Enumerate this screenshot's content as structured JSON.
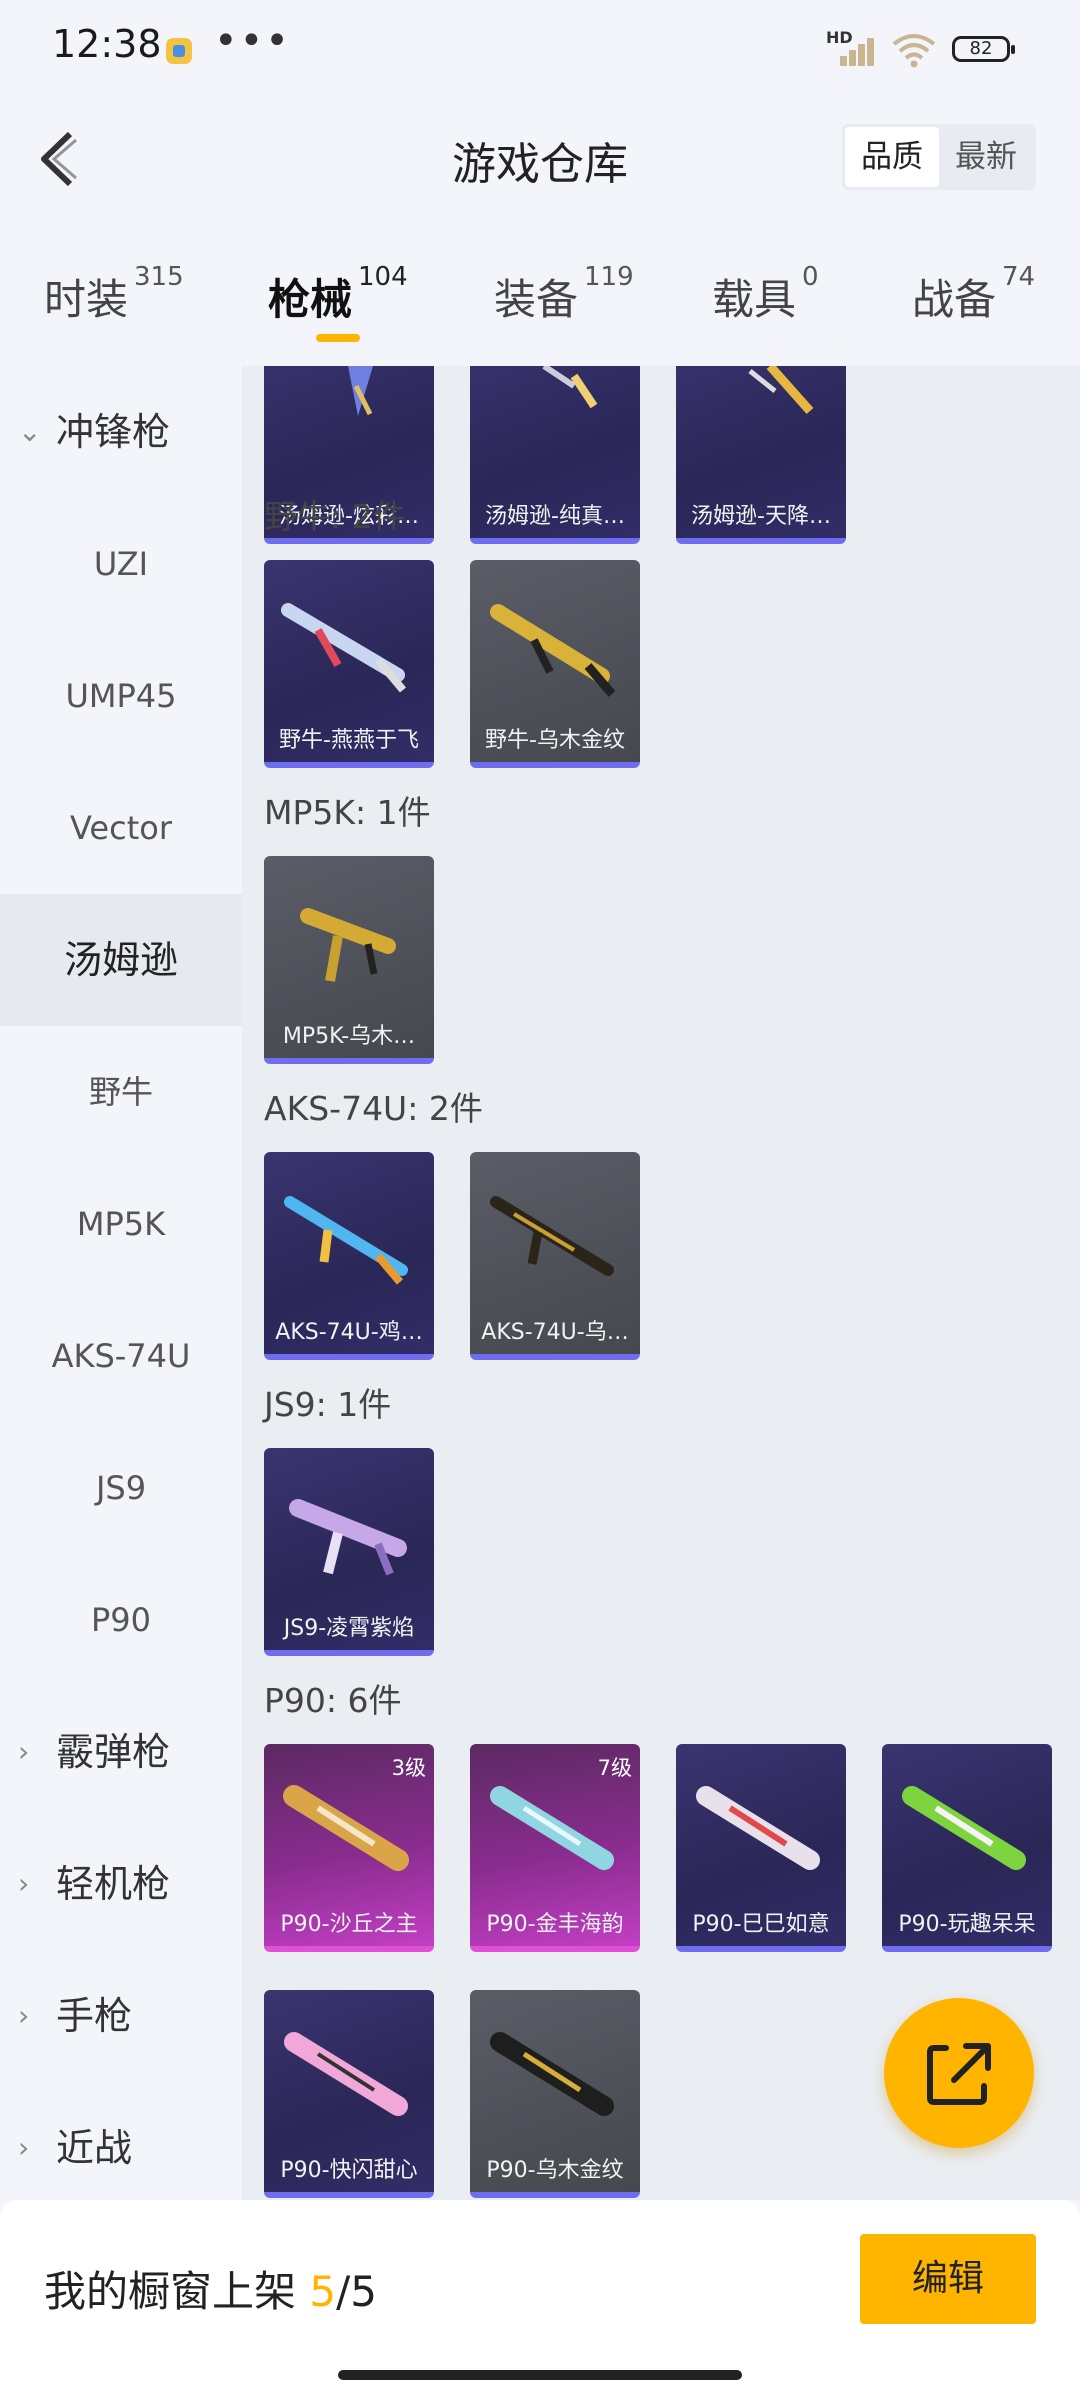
{
  "status_bar": {
    "time": "12:38",
    "dots": "•••",
    "network": "HD",
    "battery": "82"
  },
  "header": {
    "title": "游戏仓库",
    "sort_options": [
      "品质",
      "最新"
    ]
  },
  "tabs": [
    {
      "label": "时装",
      "count": "315"
    },
    {
      "label": "枪械",
      "count": "104"
    },
    {
      "label": "装备",
      "count": "119"
    },
    {
      "label": "载具",
      "count": "0"
    },
    {
      "label": "战备",
      "count": "74"
    }
  ],
  "sidebar": {
    "expanded_category": "冲锋枪",
    "items": [
      "UZI",
      "UMP45",
      "Vector",
      "汤姆逊",
      "野牛",
      "MP5K",
      "AKS-74U",
      "JS9",
      "P90"
    ],
    "collapsed_categories": [
      "霰弹枪",
      "轻机枪",
      "手枪",
      "近战"
    ]
  },
  "groups": [
    {
      "title": "",
      "cards": [
        {
          "label": "汤姆逊-炫彩…",
          "rarity": "purple"
        },
        {
          "label": "汤姆逊-纯真…",
          "rarity": "purple"
        },
        {
          "label": "汤姆逊-天降…",
          "rarity": "purple"
        }
      ]
    },
    {
      "title": "野牛: 2件",
      "cards": [
        {
          "label": "野牛-燕燕于飞",
          "rarity": "purple"
        },
        {
          "label": "野牛-乌木金纹",
          "rarity": "gray"
        }
      ]
    },
    {
      "title": "MP5K: 1件",
      "cards": [
        {
          "label": "MP5K-乌木…",
          "rarity": "gray"
        }
      ]
    },
    {
      "title": "AKS-74U: 2件",
      "cards": [
        {
          "label": "AKS-74U-鸡…",
          "rarity": "purple"
        },
        {
          "label": "AKS-74U-乌…",
          "rarity": "gray"
        }
      ]
    },
    {
      "title": "JS9: 1件",
      "cards": [
        {
          "label": "JS9-凌霄紫焰",
          "rarity": "purple"
        }
      ]
    },
    {
      "title": "P90: 6件",
      "cards": [
        {
          "label": "P90-沙丘之主",
          "rarity": "pink",
          "level": "3级"
        },
        {
          "label": "P90-金丰海韵",
          "rarity": "pink",
          "level": "7级"
        },
        {
          "label": "P90-巳巳如意",
          "rarity": "purple"
        },
        {
          "label": "P90-玩趣呆呆",
          "rarity": "purple"
        },
        {
          "label": "P90-快闪甜心",
          "rarity": "purple"
        },
        {
          "label": "P90-乌木金纹",
          "rarity": "gray"
        }
      ]
    }
  ],
  "footer": {
    "prefix": "我的橱窗上架 ",
    "used": "5",
    "suffix": "/5",
    "edit_label": "编辑"
  },
  "colors": {
    "accent": "#ffb400",
    "purple_card": "#2e2a5e",
    "gray_card": "#4f5159",
    "pink_card": "#b83ab8"
  }
}
